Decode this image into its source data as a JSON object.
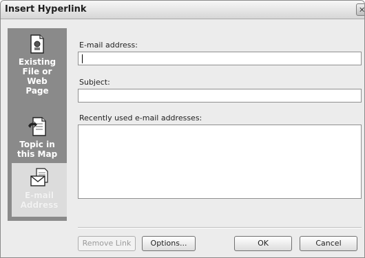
{
  "window": {
    "title": "Insert Hyperlink",
    "close_glyph": "✕"
  },
  "sidebar": {
    "items": [
      {
        "label": "Existing\nFile or\nWeb\nPage",
        "icon": "document-icon"
      },
      {
        "label": "Topic in\nthis Map",
        "icon": "topic-arrow-icon"
      },
      {
        "label": "E-mail\nAddress",
        "icon": "envelope-icon",
        "selected": true
      }
    ]
  },
  "form": {
    "email_label": "E-mail address:",
    "email_value": "",
    "subject_label": "Subject:",
    "subject_value": "",
    "recent_label": "Recently used e-mail addresses:"
  },
  "buttons": {
    "remove_link": "Remove Link",
    "options": "Options...",
    "ok": "OK",
    "cancel": "Cancel"
  }
}
